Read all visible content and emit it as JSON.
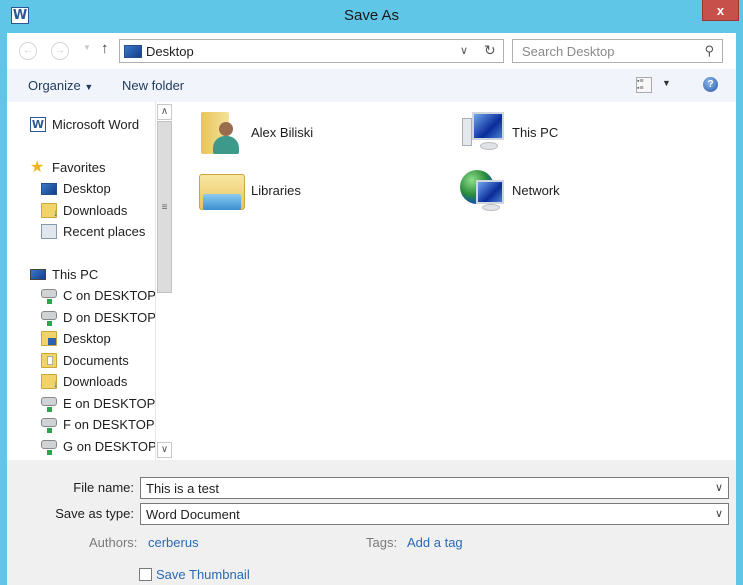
{
  "window": {
    "title": "Save As",
    "app_icon_letter": "W",
    "close_label": "x"
  },
  "navbar": {
    "back_icon": "back-arrow-icon",
    "forward_icon": "forward-arrow-icon",
    "up_icon": "up-arrow-icon",
    "address": "Desktop",
    "search_placeholder": "Search Desktop"
  },
  "toolbar": {
    "organize_label": "Organize",
    "new_folder_label": "New folder",
    "help_label": "?"
  },
  "nav_pane": {
    "items": [
      {
        "label": "Microsoft Word",
        "icon": "word-icon"
      },
      {
        "label": "Favorites",
        "icon": "star-icon"
      },
      {
        "label": "Desktop",
        "icon": "desktop-icon"
      },
      {
        "label": "Downloads",
        "icon": "downloads-folder-icon"
      },
      {
        "label": "Recent places",
        "icon": "recent-places-icon"
      },
      {
        "label": "This PC",
        "icon": "computer-icon"
      },
      {
        "label": "C on DESKTOP",
        "icon": "network-drive-icon"
      },
      {
        "label": "D on DESKTOP",
        "icon": "network-drive-icon"
      },
      {
        "label": "Desktop",
        "icon": "desktop-folder-icon"
      },
      {
        "label": "Documents",
        "icon": "documents-folder-icon"
      },
      {
        "label": "Downloads",
        "icon": "downloads-folder-icon"
      },
      {
        "label": "E on DESKTOP",
        "icon": "network-drive-icon"
      },
      {
        "label": "F on DESKTOP",
        "icon": "network-drive-icon"
      },
      {
        "label": "G on DESKTOP",
        "icon": "network-drive-icon"
      }
    ]
  },
  "content": {
    "items": [
      {
        "label": "Alex Biliski",
        "icon": "user-folder-icon"
      },
      {
        "label": "This PC",
        "icon": "computer-icon"
      },
      {
        "label": "Libraries",
        "icon": "libraries-icon"
      },
      {
        "label": "Network",
        "icon": "network-icon"
      }
    ]
  },
  "form": {
    "file_name_label": "File name:",
    "file_name_value": "This is a test",
    "save_type_label": "Save as type:",
    "save_type_value": "Word Document",
    "authors_label": "Authors:",
    "authors_value": "cerberus",
    "tags_label": "Tags:",
    "tags_value": "Add a tag",
    "thumbnail_label": "Save Thumbnail",
    "thumbnail_checked": false
  },
  "colors": {
    "frame": "#5fc6e8",
    "close": "#c7504b",
    "link": "#2a6ab4",
    "toolbar_bg": "#f1f5fb"
  }
}
